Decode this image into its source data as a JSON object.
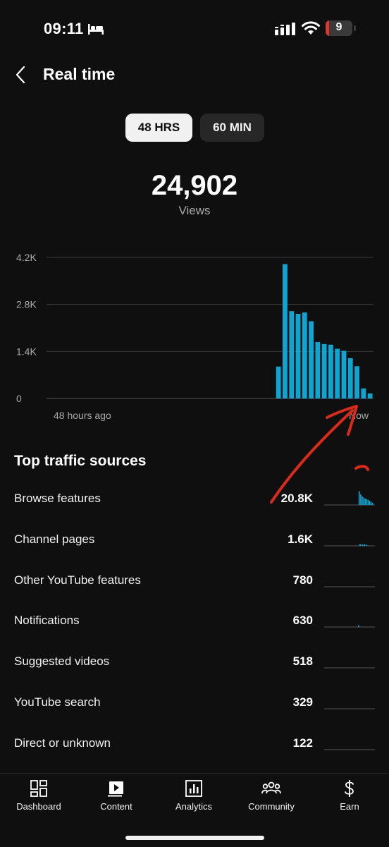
{
  "status_bar": {
    "time": "09:11",
    "battery": "9"
  },
  "header": {
    "title": "Real time"
  },
  "toggle": {
    "option_48": "48 HRS",
    "option_60": "60 MIN"
  },
  "summary": {
    "total": "24,902",
    "label": "Views"
  },
  "colors": {
    "bar": "#0ea5d2",
    "background": "#0f0f0f",
    "annotation": "#d92b1a"
  },
  "chart_data": {
    "type": "bar",
    "ylim": [
      0,
      4200
    ],
    "y_ticks": [
      "4.2K",
      "2.8K",
      "1.4K",
      "0"
    ],
    "x_labels": {
      "start": "48 hours ago",
      "end": "Now"
    },
    "grid": true,
    "categories_count": 48,
    "values": [
      0,
      0,
      0,
      0,
      0,
      0,
      0,
      0,
      0,
      0,
      0,
      0,
      0,
      0,
      0,
      0,
      0,
      0,
      0,
      0,
      0,
      0,
      0,
      0,
      0,
      0,
      0,
      0,
      0,
      0,
      0,
      0,
      0,
      0,
      0,
      950,
      4000,
      2600,
      2520,
      2560,
      2300,
      1680,
      1620,
      1600,
      1480,
      1420,
      1200,
      960,
      300,
      150
    ]
  },
  "traffic": {
    "title": "Top traffic sources",
    "rows": [
      {
        "label": "Browse features",
        "value": "20.8K"
      },
      {
        "label": "Channel pages",
        "value": "1.6K"
      },
      {
        "label": "Other YouTube features",
        "value": "780"
      },
      {
        "label": "Notifications",
        "value": "630"
      },
      {
        "label": "Suggested videos",
        "value": "518"
      },
      {
        "label": "YouTube search",
        "value": "329"
      },
      {
        "label": "Direct or unknown",
        "value": "122"
      }
    ]
  },
  "nav": {
    "dashboard": "Dashboard",
    "content": "Content",
    "analytics": "Analytics",
    "community": "Community",
    "earn": "Earn"
  }
}
